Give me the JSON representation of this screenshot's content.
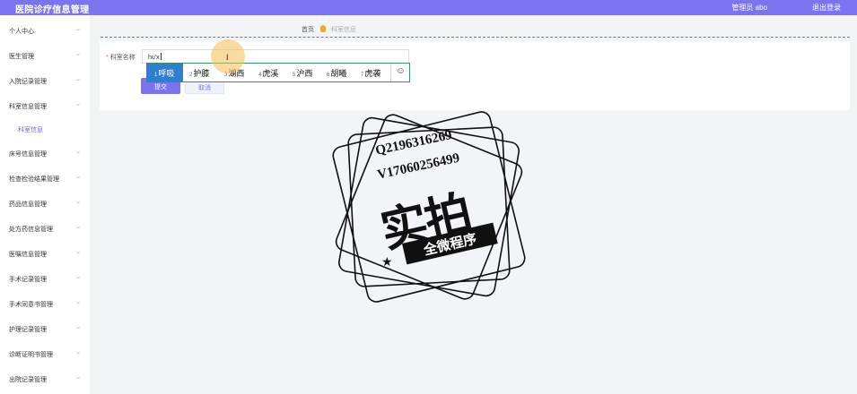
{
  "header": {
    "app_title": "医院诊疗信息管理",
    "user_label": "管理员 abo",
    "logout_label": "退出登录"
  },
  "sidebar": {
    "items": [
      {
        "label": "个人中心",
        "expandable": true
      },
      {
        "label": "医生管理",
        "expandable": true
      },
      {
        "label": "入院记录管理",
        "expandable": true
      },
      {
        "label": "科室信息管理",
        "expandable": true
      },
      {
        "label": "科室信息",
        "expandable": false,
        "active": true
      },
      {
        "label": "床号信息管理",
        "expandable": true
      },
      {
        "label": "检查检验结果管理",
        "expandable": true
      },
      {
        "label": "药品信息管理",
        "expandable": true
      },
      {
        "label": "处方药信息管理",
        "expandable": true
      },
      {
        "label": "医嘱信息管理",
        "expandable": true
      },
      {
        "label": "手术记录管理",
        "expandable": true
      },
      {
        "label": "手术同意书管理",
        "expandable": true
      },
      {
        "label": "护理记录管理",
        "expandable": true
      },
      {
        "label": "诊断证明书管理",
        "expandable": true
      },
      {
        "label": "出院记录管理",
        "expandable": true
      }
    ]
  },
  "breadcrumb": {
    "home": "首页",
    "current": "科室信息"
  },
  "form": {
    "field_label": "科室名称",
    "required_mark": "*",
    "field_value": "hu'x",
    "submit_label": "提交",
    "cancel_label": "取消"
  },
  "ime": {
    "candidates": [
      {
        "num": "1",
        "text": "呼吸",
        "selected": true
      },
      {
        "num": "2",
        "text": "护膝"
      },
      {
        "num": "3",
        "text": "湖西"
      },
      {
        "num": "4",
        "text": "虎溪"
      },
      {
        "num": "5",
        "text": "沪西"
      },
      {
        "num": "6",
        "text": "胡曦"
      },
      {
        "num": "7",
        "text": "虎袭"
      }
    ],
    "emoji_icon": "smiley-icon"
  },
  "watermark": {
    "line1": "Q2196316269",
    "line2": "V17060256499",
    "main": "实拍",
    "banner": "全微程序"
  },
  "colors": {
    "accent": "#7b74ee",
    "ime_selected": "#2f7fd0",
    "ime_border": "#3a8c6a",
    "breadcrumb_icon": "#f1a725"
  }
}
